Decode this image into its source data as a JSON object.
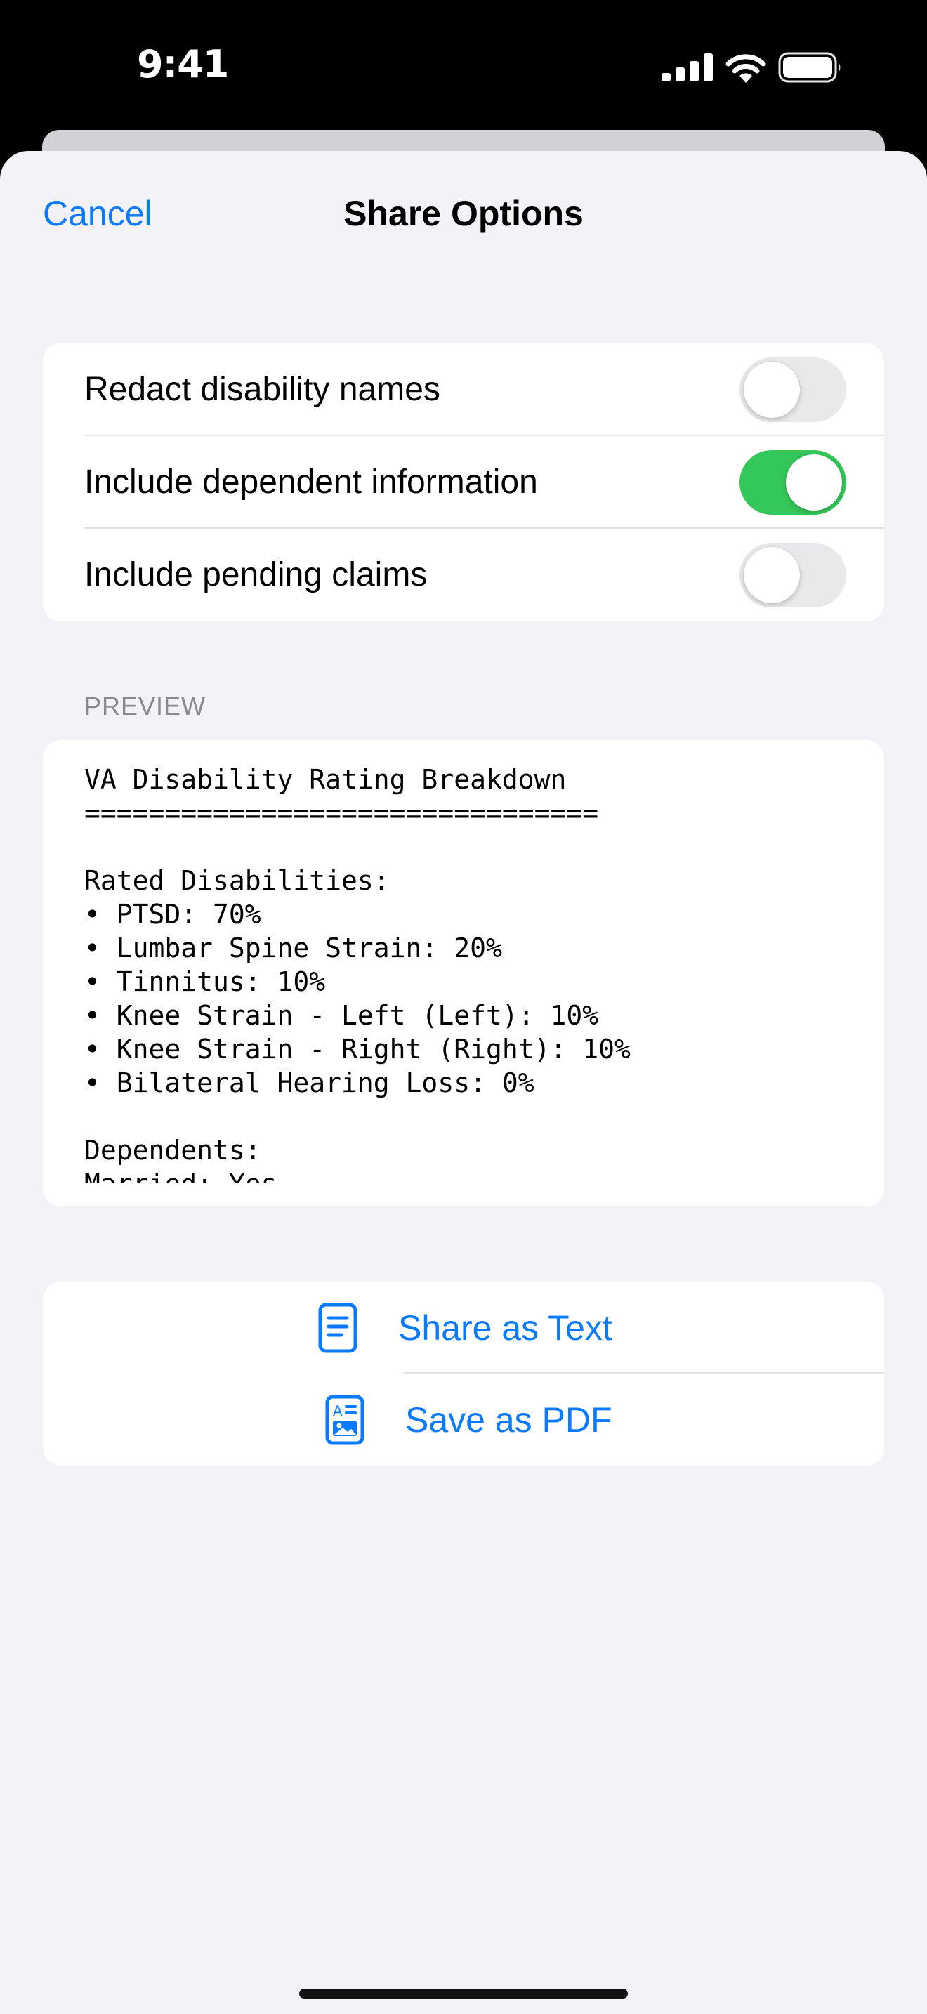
{
  "status_bar": {
    "time": "9:41",
    "icons": [
      "cellular-signal-icon",
      "wifi-icon",
      "battery-icon"
    ]
  },
  "nav": {
    "cancel_label": "Cancel",
    "title": "Share Options"
  },
  "options": [
    {
      "label": "Redact disability names",
      "enabled": false
    },
    {
      "label": "Include dependent information",
      "enabled": true
    },
    {
      "label": "Include pending claims",
      "enabled": false
    }
  ],
  "preview": {
    "header": "PREVIEW",
    "text": "VA Disability Rating Breakdown\n================================\n\nRated Disabilities:\n• PTSD: 70%\n• Lumbar Spine Strain: 20%\n• Tinnitus: 10%\n• Knee Strain - Left (Left): 10%\n• Knee Strain - Right (Right): 10%\n• Bilateral Hearing Loss: 0%\n\nDependents:\nMarried: Yes"
  },
  "actions": [
    {
      "label": "Share as Text",
      "icon": "document-text-icon"
    },
    {
      "label": "Save as PDF",
      "icon": "document-richtext-icon"
    }
  ],
  "colors": {
    "accent": "#0a7aff",
    "toggle_on": "#34c759",
    "toggle_off": "#e9e9eb",
    "background": "#f2f2f7"
  }
}
